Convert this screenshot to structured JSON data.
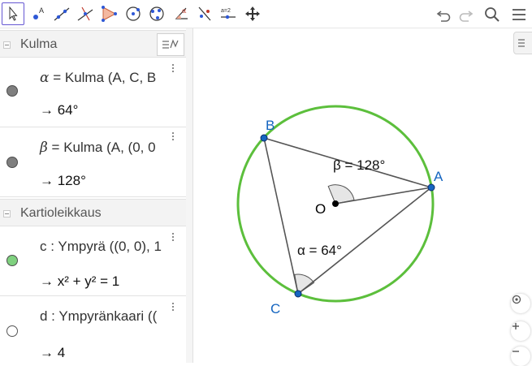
{
  "toolbar": {
    "left_tools": [
      {
        "name": "move-tool",
        "active": true
      },
      {
        "name": "point-tool"
      },
      {
        "name": "line-tool"
      },
      {
        "name": "perpendicular-line-tool"
      },
      {
        "name": "polygon-tool"
      },
      {
        "name": "circle-tool"
      },
      {
        "name": "circle-three-points-tool"
      },
      {
        "name": "angle-tool"
      },
      {
        "name": "reflect-tool"
      },
      {
        "name": "slider-tool",
        "label": "a=2"
      },
      {
        "name": "move-graphics-view-tool"
      }
    ],
    "right_tools": [
      "undo-icon",
      "redo-icon",
      "search-icon",
      "menu-icon"
    ]
  },
  "algebra": {
    "groups": [
      {
        "title": "Kulma",
        "items": [
          {
            "symbol": "α",
            "definition": " = Kulma (A, C, B",
            "value": "→ 64°",
            "color": "#7f7f7f"
          },
          {
            "symbol": "β",
            "definition": " = Kulma (A, (0, 0",
            "value": "→ 128°",
            "color": "#7f7f7f"
          }
        ]
      },
      {
        "title": "Kartioleikkaus",
        "items": [
          {
            "symbol": "",
            "definition": "c : Ympyrä ((0, 0), 1",
            "value": "→ x² + y² = 1",
            "color": "#7fd17f"
          },
          {
            "symbol": "",
            "definition": "d : Ympyränkaari ((",
            "value": "→ 4",
            "color": "#ffffff"
          }
        ]
      }
    ]
  },
  "graphics": {
    "points": [
      {
        "label": "A",
        "color": "#1565c0"
      },
      {
        "label": "B",
        "color": "#1565c0"
      },
      {
        "label": "C",
        "color": "#1565c0"
      },
      {
        "label": "O",
        "color": "#000000"
      }
    ],
    "angle_labels": {
      "beta": "β = 128°",
      "alpha": "α = 64°"
    },
    "circle_color": "#5cbf3c",
    "side_buttons": [
      "center-icon",
      "zoom-in-icon",
      "zoom-out-icon"
    ]
  }
}
